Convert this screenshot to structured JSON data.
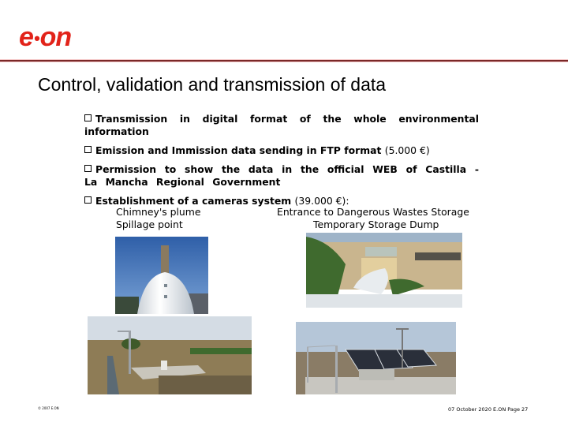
{
  "header": {
    "logo": {
      "text_e": "e",
      "text_on": "on",
      "color": "#e2231a"
    },
    "rule_color": "#7a2828"
  },
  "slide": {
    "title": "Control, validation and transmission of data",
    "bullets": [
      {
        "icon": "checkbox-bullet-icon",
        "text": "Transmission in digital format of the whole environmental information",
        "cost": ""
      },
      {
        "icon": "checkbox-bullet-icon",
        "text": "Emission and Immission data sending in FTP format",
        "cost": "(5.000 €)"
      },
      {
        "icon": "checkbox-bullet-icon",
        "text": "Permission to show the data in the official WEB of Castilla - La Mancha Regional Government",
        "cost": ""
      },
      {
        "icon": "checkbox-bullet-icon",
        "text": "Establishment of a cameras system",
        "cost": "(39.000 €):"
      }
    ],
    "camera_locations": [
      "Chimney's plume",
      "Entrance to Dangerous Wastes Storage",
      "Spillage point",
      "Temporary Storage Dump"
    ],
    "photos": [
      {
        "name": "chimney-plume-photo",
        "alt": "White chimney stack against blue sky"
      },
      {
        "name": "temporary-storage-dump-photo",
        "alt": "Camera housing overlooking storage dump site"
      },
      {
        "name": "spillage-point-photo",
        "alt": "Water channel with monitoring station"
      },
      {
        "name": "dangerous-wastes-storage-photo",
        "alt": "Fenced solar panel installation"
      }
    ]
  },
  "footer": {
    "left": "© 2007 E.ON",
    "right": "07 October 2020 E.ON Page 27"
  }
}
